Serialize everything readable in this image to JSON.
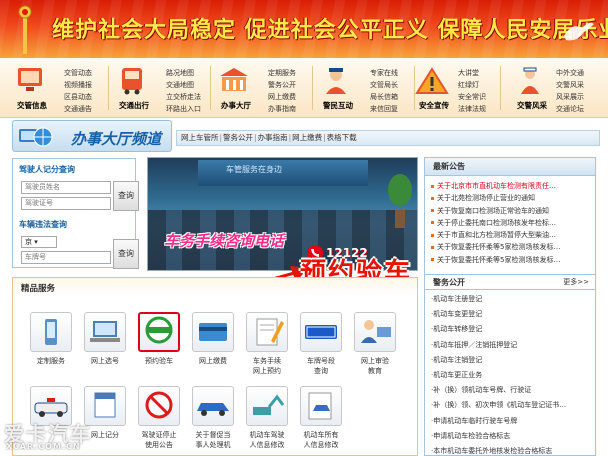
{
  "banner": {
    "title": "维护社会大局稳定  促进社会公平正义  保障人民安居乐业"
  },
  "categories": [
    {
      "label": "交管信息",
      "links": [
        "交管动态",
        "视频播报",
        "区县动态",
        "交通通告"
      ]
    },
    {
      "label": "交通出行",
      "links": [
        "路况地图",
        "交通地图",
        "立交桥走法",
        "环路出入口"
      ]
    },
    {
      "label": "办事大厅",
      "links": [
        "定期服务",
        "警务公开",
        "网上缴费",
        "办事指南"
      ]
    },
    {
      "label": "警民互动",
      "links": [
        "专家在线",
        "交管局长",
        "局长信箱",
        "来信回复"
      ]
    },
    {
      "label": "安全宣传",
      "links": [
        "大讲堂",
        "红绿灯",
        "安全常识",
        "法律法规"
      ]
    },
    {
      "label": "交警风采",
      "links": [
        "中外交通",
        "交警风采",
        "风采展示",
        "交通论坛"
      ]
    }
  ],
  "channel": {
    "title": "办事大厅频道",
    "menu": [
      "网上车管所",
      "警务公开",
      "办事指南",
      "网上缴费",
      "表格下载"
    ]
  },
  "query": {
    "driver_title": "驾驶人记分查询",
    "driver_name_ph": "驾驶员姓名",
    "driver_id_ph": "驾驶证号",
    "query_btn": "查询",
    "vehicle_title": "车辆违法查询",
    "province": "京",
    "plate_ph": "车牌号",
    "engine_ph": "发动机号后4位",
    "query_btn2": "查询"
  },
  "photo": {
    "board_text": "车管服务在身边",
    "slogan": "车务手续咨询电话",
    "phone": "12122"
  },
  "callout": "预约验车",
  "notices": {
    "title": "最新公告",
    "items": [
      {
        "text": "关于北京市市直机动车检测有限责任…",
        "red": true
      },
      {
        "text": "关于北苑检测场停止营业的通知",
        "red": false
      },
      {
        "text": "关于恢复南口检测场正常验车的通知",
        "red": false
      },
      {
        "text": "关于停止委托南口检测场核发年检标…",
        "red": false
      },
      {
        "text": "关于市直和北方检测场暂停大型柴油…",
        "red": false
      },
      {
        "text": "关于恢复委托怀柔等5家检测场核发标…",
        "red": false
      },
      {
        "text": "关于恢复委托怀柔等5家检测场核发标…",
        "red": false
      }
    ]
  },
  "affairs": {
    "title": "警务公开",
    "more": "更多>>",
    "items": [
      "·机动车注册登记",
      "·机动车变更登记",
      "·机动车转移登记",
      "·机动车抵押／注销抵押登记",
      "·机动车注销登记",
      "·机动车更正业务",
      "·补（换）领机动车号牌、行驶证",
      "·补（换）领、初次申领《机动车登记证书…",
      "·申请机动车临时行驶车号牌",
      "·申请机动车检验合格标志",
      "·本市机动车委托外地核发检验合格标志"
    ]
  },
  "services": {
    "title": "精品服务",
    "items": [
      {
        "label": "定制服务",
        "label2": ""
      },
      {
        "label": "网上选号",
        "label2": ""
      },
      {
        "label": "预约验车",
        "label2": ""
      },
      {
        "label": "网上缴费",
        "label2": ""
      },
      {
        "label": "车务手续",
        "label2": "网上预约"
      },
      {
        "label": "车牌号段",
        "label2": "查询"
      },
      {
        "label": "网上审验",
        "label2": "教育"
      },
      {
        "label": "",
        "label2": ""
      },
      {
        "label": "网上记分",
        "label2": ""
      },
      {
        "label": "驾驶证停止",
        "label2": "使用公告"
      },
      {
        "label": "关于督促当",
        "label2": "事人处理机"
      },
      {
        "label": "机动车驾驶",
        "label2": "人信息修改"
      },
      {
        "label": "机动车所有",
        "label2": "人信息修改"
      }
    ],
    "sel_badge": "预约验车"
  },
  "watermark": {
    "logo_text": "爱卡汽车",
    "site_text": "XCAR.COM.CN"
  },
  "colors": {
    "banner_red": "#d81e06",
    "banner_yellow": "#ffe94a",
    "link_blue": "#1760a6",
    "notice_red": "#e0001a",
    "callout_red": "#e81200"
  }
}
